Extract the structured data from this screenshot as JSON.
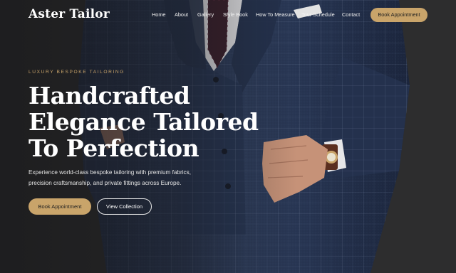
{
  "brand": {
    "name": "Aster Tailor"
  },
  "nav": {
    "items": [
      {
        "label": "Home"
      },
      {
        "label": "About"
      },
      {
        "label": "Gallery"
      },
      {
        "label": "Style Book"
      },
      {
        "label": "How To Measure"
      },
      {
        "label": "Tour Schedule"
      },
      {
        "label": "Contact"
      }
    ],
    "cta_label": "Book Appointment"
  },
  "hero": {
    "eyebrow": "LUXURY BESPOKE TAILORING",
    "headline_lines": [
      "Handcrafted",
      "Elegance Tailored",
      "To Perfection"
    ],
    "description_lines": [
      "Experience world-class bespoke tailoring with premium fabrics,",
      "precision craftsmanship, and private fittings across Europe."
    ],
    "primary_button": "Book Appointment",
    "secondary_button": "View Collection"
  },
  "colors": {
    "accent": "#c9a46a",
    "background": "#2c2c2c",
    "suit": "#2b3a58",
    "text": "#ffffff"
  }
}
